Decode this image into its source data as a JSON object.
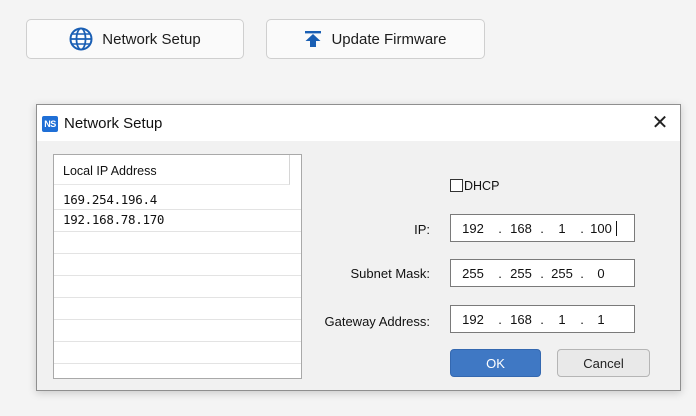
{
  "toolbar": {
    "network_setup_label": "Network Setup",
    "update_firmware_label": "Update Firmware"
  },
  "dialog": {
    "app_icon_text": "NS",
    "title": "Network Setup",
    "close_glyph": "✕",
    "list": {
      "header": "Local IP Address",
      "items": [
        "169.254.196.4",
        "192.168.78.170"
      ]
    },
    "dhcp": {
      "label": "DHCP",
      "checked": false
    },
    "fields": {
      "ip": {
        "label": "IP:",
        "octets": [
          "192",
          "168",
          "1",
          "100"
        ]
      },
      "subnet_mask": {
        "label": "Subnet Mask:",
        "octets": [
          "255",
          "255",
          "255",
          "0"
        ]
      },
      "gateway": {
        "label": "Gateway Address:",
        "octets": [
          "192",
          "168",
          "1",
          "1"
        ]
      }
    },
    "ok_label": "OK",
    "cancel_label": "Cancel"
  },
  "colors": {
    "ok_button": "#3f78c4",
    "app_icon": "#1f6fd6",
    "globe_icon": "#1a5fb4",
    "upload_icon": "#1a5fb4"
  }
}
